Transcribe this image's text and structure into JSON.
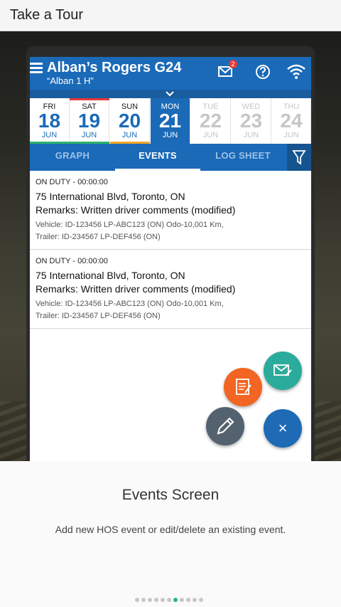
{
  "header": {
    "title": "Take a Tour"
  },
  "app": {
    "title": "Alban’s Rogers G24",
    "subtitle": "“Alban 1 H”",
    "mail_badge": "2"
  },
  "days": [
    {
      "name": "FRI",
      "num": "18",
      "mon": "JUN"
    },
    {
      "name": "SAT",
      "num": "19",
      "mon": "JUN"
    },
    {
      "name": "SUN",
      "num": "20",
      "mon": "JUN"
    },
    {
      "name": "MON",
      "num": "21",
      "mon": "JUN"
    },
    {
      "name": "TUE",
      "num": "22",
      "mon": "JUN"
    },
    {
      "name": "WED",
      "num": "23",
      "mon": "JUN"
    },
    {
      "name": "THU",
      "num": "24",
      "mon": "JUN"
    }
  ],
  "tabs": [
    {
      "label": "GRAPH"
    },
    {
      "label": "EVENTS"
    },
    {
      "label": "LOG SHEET"
    }
  ],
  "events": [
    {
      "status": "ON DUTY - 00:00:00",
      "address": "75 International Blvd, Toronto, ON",
      "remarks": "Remarks: Written driver comments (modified)",
      "vehicle_line1": "Vehicle: ID-123456 LP-ABC123 (ON) Odo-10,001 Km,",
      "vehicle_line2": "Trailer: ID-234567 LP-DEF456 (ON)"
    },
    {
      "status": "ON DUTY - 00:00:00",
      "address": "75 International Blvd, Toronto, ON",
      "remarks": "Remarks: Written driver comments (modified)",
      "vehicle_line1": "Vehicle: ID-123456 LP-ABC123 (ON) Odo-10,001 Km,",
      "vehicle_line2": "Trailer: ID-234567 LP-DEF456 (ON)"
    }
  ],
  "fab": {
    "close_symbol": "×"
  },
  "tour": {
    "title": "Events Screen",
    "description": "Add new HOS event or edit/delete an existing event.",
    "page_count": 11,
    "current_page": 7
  },
  "colors": {
    "primary": "#1a6ab8",
    "teal_fab": "#2bab9c",
    "orange_fab": "#f26522",
    "gray_fab": "#546270",
    "blue_fab": "#1e6ab5",
    "sat_bar": "#e53935",
    "green_bar": "#2eb36a",
    "sun_bar": "#f5a623"
  },
  "icons": [
    "menu-icon",
    "mail-icon",
    "help-icon",
    "wifi-icon",
    "chevron-down-icon",
    "filter-icon",
    "mail-edit-icon",
    "notepad-icon",
    "pencil-icon",
    "close-icon"
  ]
}
